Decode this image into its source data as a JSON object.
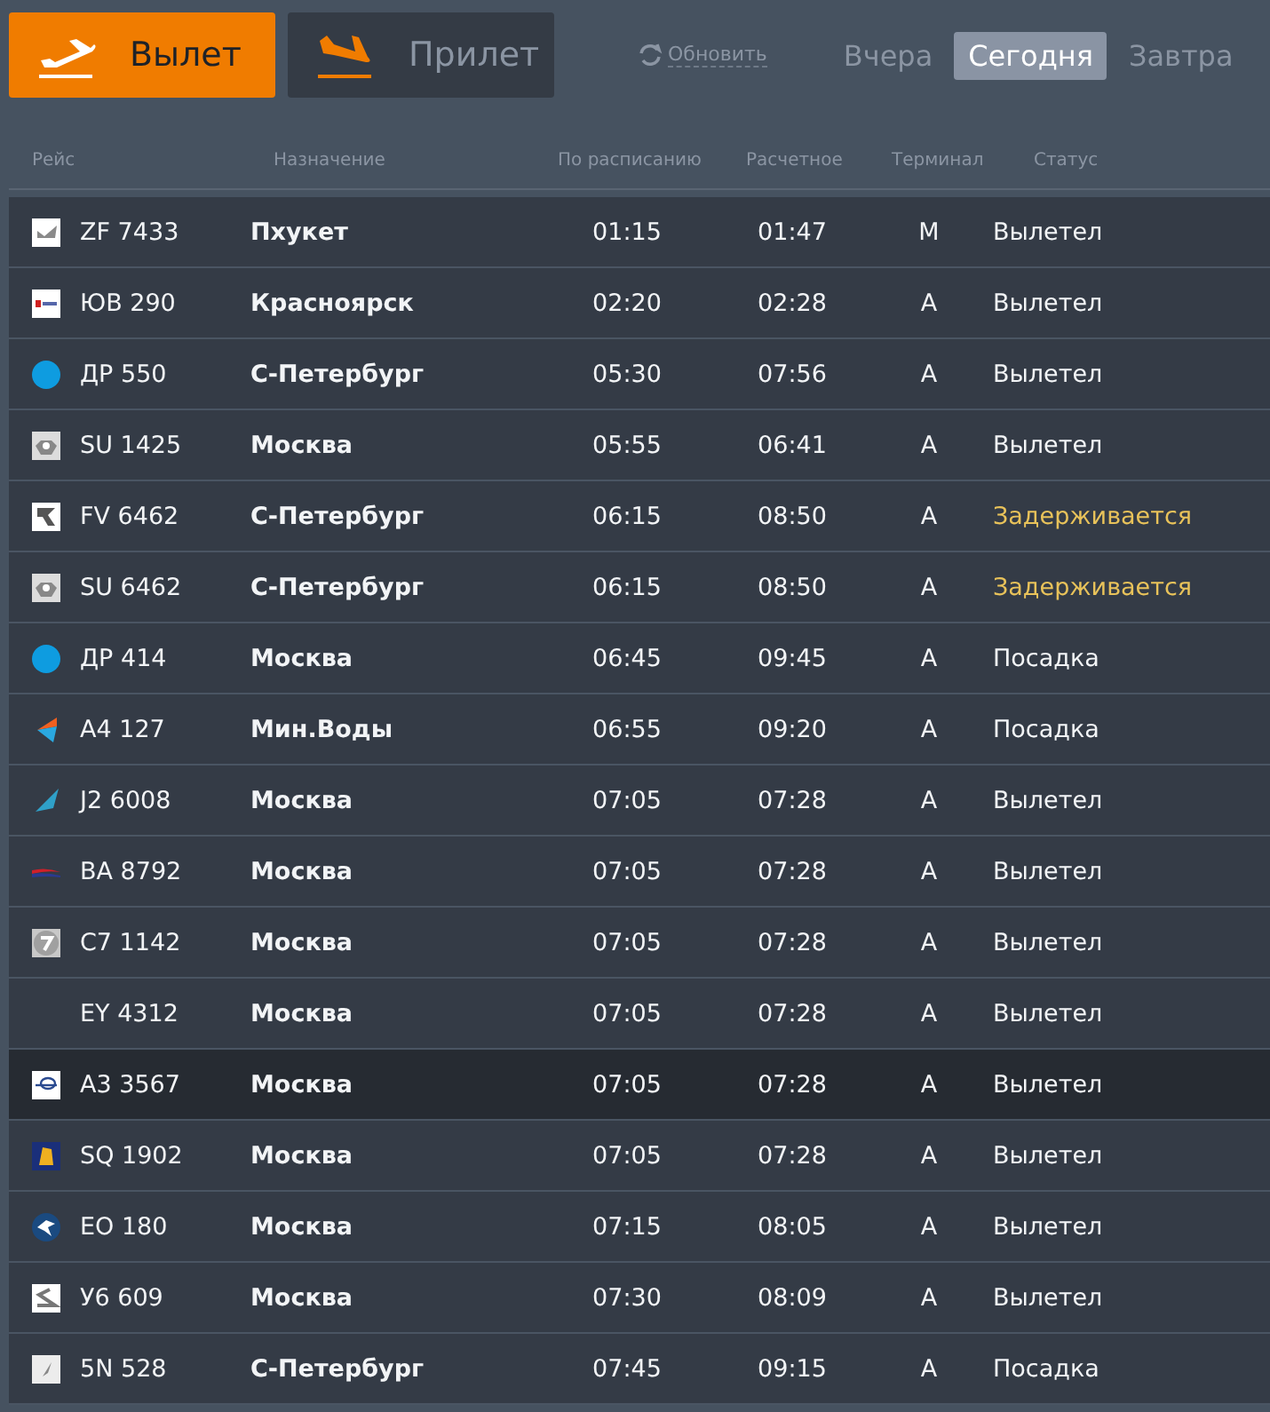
{
  "direction_tabs": [
    {
      "label": "Вылет",
      "kind": "departure",
      "selected": true
    },
    {
      "label": "Прилет",
      "kind": "arrival",
      "selected": false
    }
  ],
  "refresh": {
    "label": "Обновить"
  },
  "day_tabs": [
    {
      "label": "Вчера",
      "selected": false
    },
    {
      "label": "Сегодня",
      "selected": true
    },
    {
      "label": "Завтра",
      "selected": false
    }
  ],
  "table": {
    "columns": [
      "Рейс",
      "Назначение",
      "По расписанию",
      "Расчетное",
      "Терминал",
      "Статус"
    ],
    "rows": [
      {
        "logo": {
          "kind": "check"
        },
        "flight": "ZF 7433",
        "destination": "Пхукет",
        "scheduled": "01:15",
        "estimated": "01:47",
        "terminal": "M",
        "status": {
          "text": "Вылетел",
          "kind": "normal"
        },
        "selected": false
      },
      {
        "logo": {
          "kind": "banner"
        },
        "flight": "ЮВ 290",
        "destination": "Красноярск",
        "scheduled": "02:20",
        "estimated": "02:28",
        "terminal": "A",
        "status": {
          "text": "Вылетел",
          "kind": "normal"
        },
        "selected": false
      },
      {
        "logo": {
          "kind": "dot"
        },
        "flight": "ДР 550",
        "destination": "С-Петербург",
        "scheduled": "05:30",
        "estimated": "07:56",
        "terminal": "A",
        "status": {
          "text": "Вылетел",
          "kind": "normal"
        },
        "selected": false
      },
      {
        "logo": {
          "kind": "emblem"
        },
        "flight": "SU 1425",
        "destination": "Москва",
        "scheduled": "05:55",
        "estimated": "06:41",
        "terminal": "A",
        "status": {
          "text": "Вылетел",
          "kind": "normal"
        },
        "selected": false
      },
      {
        "logo": {
          "kind": "curve"
        },
        "flight": "FV 6462",
        "destination": "С-Петербург",
        "scheduled": "06:15",
        "estimated": "08:50",
        "terminal": "A",
        "status": {
          "text": "Задерживается",
          "kind": "delayed"
        },
        "selected": false
      },
      {
        "logo": {
          "kind": "emblem"
        },
        "flight": "SU 6462",
        "destination": "С-Петербург",
        "scheduled": "06:15",
        "estimated": "08:50",
        "terminal": "A",
        "status": {
          "text": "Задерживается",
          "kind": "delayed"
        },
        "selected": false
      },
      {
        "logo": {
          "kind": "dot"
        },
        "flight": "ДР 414",
        "destination": "Москва",
        "scheduled": "06:45",
        "estimated": "09:45",
        "terminal": "A",
        "status": {
          "text": "Посадка",
          "kind": "normal"
        },
        "selected": false
      },
      {
        "logo": {
          "kind": "chevron"
        },
        "flight": "A4 127",
        "destination": "Мин.Воды",
        "scheduled": "06:55",
        "estimated": "09:20",
        "terminal": "A",
        "status": {
          "text": "Посадка",
          "kind": "normal"
        },
        "selected": false
      },
      {
        "logo": {
          "kind": "fin"
        },
        "flight": "J2 6008",
        "destination": "Москва",
        "scheduled": "07:05",
        "estimated": "07:28",
        "terminal": "A",
        "status": {
          "text": "Вылетел",
          "kind": "normal"
        },
        "selected": false
      },
      {
        "logo": {
          "kind": "ribbon"
        },
        "flight": "BA 8792",
        "destination": "Москва",
        "scheduled": "07:05",
        "estimated": "07:28",
        "terminal": "A",
        "status": {
          "text": "Вылетел",
          "kind": "normal"
        },
        "selected": false
      },
      {
        "logo": {
          "kind": "roundel"
        },
        "flight": "C7 1142",
        "destination": "Москва",
        "scheduled": "07:05",
        "estimated": "07:28",
        "terminal": "A",
        "status": {
          "text": "Вылетел",
          "kind": "normal"
        },
        "selected": false
      },
      {
        "flight": "EY 4312",
        "destination": "Москва",
        "scheduled": "07:05",
        "estimated": "07:28",
        "terminal": "A",
        "status": {
          "text": "Вылетел",
          "kind": "normal"
        },
        "selected": false
      },
      {
        "logo": {
          "kind": "wings"
        },
        "flight": "A3 3567",
        "destination": "Москва",
        "scheduled": "07:05",
        "estimated": "07:28",
        "terminal": "A",
        "status": {
          "text": "Вылетел",
          "kind": "normal"
        },
        "selected": true
      },
      {
        "logo": {
          "kind": "bird"
        },
        "flight": "SQ 1902",
        "destination": "Москва",
        "scheduled": "07:05",
        "estimated": "07:28",
        "terminal": "A",
        "status": {
          "text": "Вылетел",
          "kind": "normal"
        },
        "selected": false
      },
      {
        "logo": {
          "kind": "pegasus"
        },
        "flight": "EO 180",
        "destination": "Москва",
        "scheduled": "07:15",
        "estimated": "08:05",
        "terminal": "A",
        "status": {
          "text": "Вылетел",
          "kind": "normal"
        },
        "selected": false
      },
      {
        "logo": {
          "kind": "loop"
        },
        "flight": "У6 609",
        "destination": "Москва",
        "scheduled": "07:30",
        "estimated": "08:09",
        "terminal": "A",
        "status": {
          "text": "Вылетел",
          "kind": "normal"
        },
        "selected": false
      },
      {
        "logo": {
          "kind": "feather"
        },
        "flight": "5N 528",
        "destination": "С-Петербург",
        "scheduled": "07:45",
        "estimated": "09:15",
        "terminal": "A",
        "status": {
          "text": "Посадка",
          "kind": "normal"
        },
        "selected": false
      }
    ]
  }
}
